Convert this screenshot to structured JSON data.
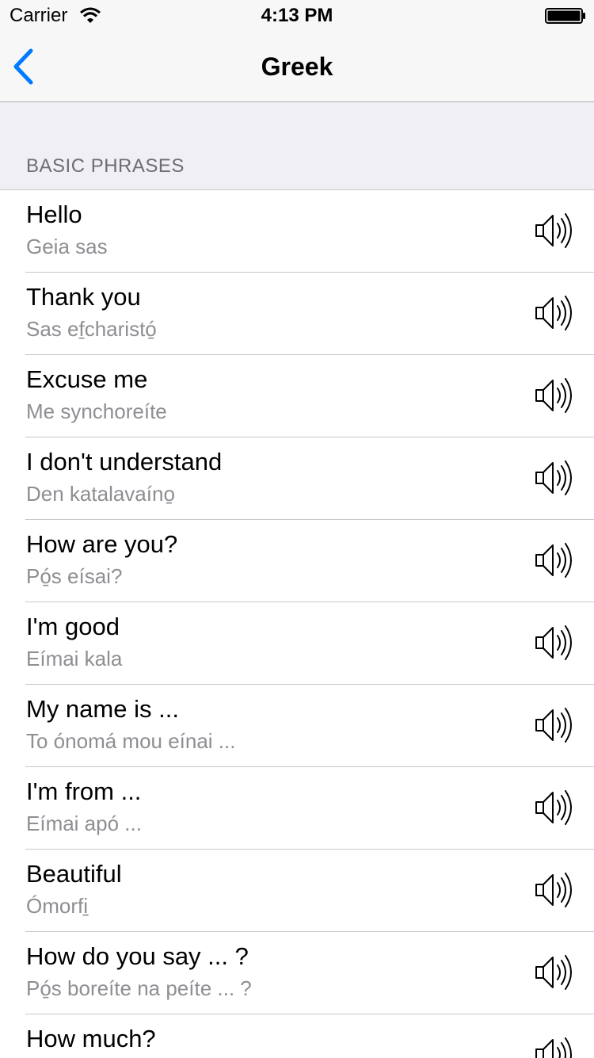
{
  "status_bar": {
    "carrier": "Carrier",
    "time": "4:13 PM"
  },
  "nav": {
    "title": "Greek",
    "back_icon": "chevron-left-icon"
  },
  "section": {
    "header": "BASIC PHRASES"
  },
  "phrases": [
    {
      "english": "Hello",
      "greek": "Geia sas"
    },
    {
      "english": "Thank you",
      "greek": "Sas ef̱charistó̱"
    },
    {
      "english": "Excuse me",
      "greek": "Me synchoreíte"
    },
    {
      "english": "I don't understand",
      "greek": "Den katalavaíno̱"
    },
    {
      "english": "How are you?",
      "greek": "Pó̱s eísai?"
    },
    {
      "english": "I'm good",
      "greek": "Eímai kala"
    },
    {
      "english": "My name is ...",
      "greek": "To ónomá mou eínai ..."
    },
    {
      "english": "I'm from ...",
      "greek": "Eímai apó ..."
    },
    {
      "english": "Beautiful",
      "greek": "Ómorfi̱"
    },
    {
      "english": "How do you say ... ?",
      "greek": "Pó̱s boreíte na peíte ... ?"
    },
    {
      "english": "How much?",
      "greek": ""
    }
  ],
  "icons": {
    "play": "speaker-icon"
  }
}
